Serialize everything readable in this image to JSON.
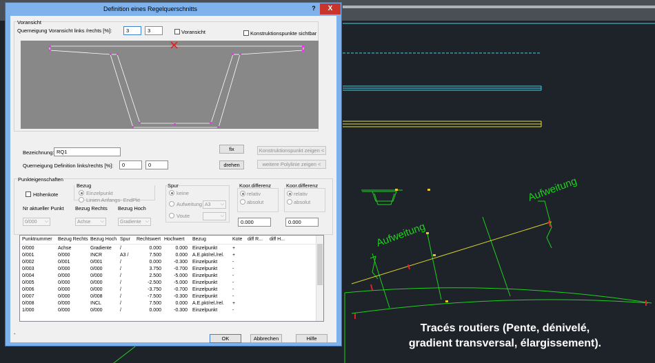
{
  "dialog": {
    "title": "Definition eines Regelquerschnitts",
    "help_glyph": "?",
    "close_glyph": "X",
    "preview_group": "Voransicht",
    "slope_label": "Querneigung Voransicht links /rechts [%]:",
    "slope_left": "3",
    "slope_right": "3",
    "voransicht_check": "Voransicht",
    "construction_points_check": "Konstruktionspunkte sichtbar",
    "name_label": "Bezeichnung:",
    "name_value": "RQ1",
    "slope_def_label": "Querneigung Definition links/rechts [%]:",
    "slope_def_left": "0",
    "slope_def_right": "0",
    "fix_button": "fix",
    "turn_button": "drehen",
    "show_construction_point_button": "Konstruktionspunkt zeigen <",
    "show_more_polyline_button": "weitere Polylinie zeigen <",
    "point_props_group": "Punkteigenschaften",
    "height_check": "Höhenkote",
    "current_point_label": "Nr aktueller Punkt",
    "current_point_value": "0/000",
    "bezug_group": "Bezug",
    "bezug_single": "Einzelpunkt",
    "bezug_lines": "Linien Anfangs- EndPkt",
    "bezug_right_label": "Bezug Rechts",
    "bezug_right_value": "Achse",
    "bezug_high_label": "Bezug Hoch",
    "bezug_high_value": "Gradiente",
    "spur_group": "Spur",
    "spur_none": "keine",
    "spur_widen": "Aufweitung",
    "spur_widen_value": "A3",
    "spur_voute": "Voute",
    "koor1_group": "Koor.differenz",
    "koor1_rel": "relativ",
    "koor1_abs": "absolut",
    "koor1_value": "0.000",
    "koor2_group": "Koor.differenz",
    "koor2_rel": "relativ",
    "koor2_abs": "absolut",
    "koor2_value": "0.000",
    "ok_button": "OK",
    "cancel_button": "Abbrechen",
    "help_button": "Hilfe",
    "footer_mark": "-"
  },
  "table": {
    "columns": [
      "Punktnummer",
      "Bezug Rechts",
      "Bezug Hoch",
      "Spur",
      "Rechtswert",
      "Hochwert",
      "Bezug",
      "Kote",
      "diff R...",
      "diff H..."
    ],
    "rows": [
      [
        "0/000",
        "Achse",
        "Gradiente",
        "/",
        "0.000",
        "0.000",
        "Einzelpunkt",
        "+"
      ],
      [
        "0/001",
        "0/000",
        "INCR",
        "A3 /",
        "7.500",
        "0.000",
        "A.E.pkt/rel./rel.",
        "+"
      ],
      [
        "0/002",
        "0/001",
        "0/001",
        "/",
        "0.000",
        "-0.300",
        "Einzelpunkt",
        "-"
      ],
      [
        "0/003",
        "0/000",
        "0/000",
        "/",
        "3.750",
        "-0.700",
        "Einzelpunkt",
        "-"
      ],
      [
        "0/004",
        "0/000",
        "0/000",
        "/",
        "2.500",
        "-5.000",
        "Einzelpunkt",
        "-"
      ],
      [
        "0/005",
        "0/000",
        "0/000",
        "/",
        "-2.500",
        "-5.000",
        "Einzelpunkt",
        "-"
      ],
      [
        "0/006",
        "0/000",
        "0/000",
        "/",
        "-3.750",
        "-0.700",
        "Einzelpunkt",
        "-"
      ],
      [
        "0/007",
        "0/000",
        "0/008",
        "/",
        "-7.500",
        "-0.300",
        "Einzelpunkt",
        "-"
      ],
      [
        "0/008",
        "0/000",
        "INCL",
        "/",
        "7.500",
        "0.000",
        "A.E.pkt/rel./rel.",
        "+"
      ],
      [
        "1/000",
        "0/000",
        "0/000",
        "/",
        "0.000",
        "-0.300",
        "Einzelpunkt",
        "-"
      ]
    ]
  },
  "cad": {
    "label_left": "Aufweitung",
    "label_right": "Aufweitung",
    "colors": {
      "background": "#1e2329",
      "cyan": "#3fd6e6",
      "yellow": "#e8e23a",
      "green": "#1ed21e",
      "red": "#e21f1f"
    }
  },
  "caption": {
    "line1": "Tracés routiers (Pente, dénivelé,",
    "line2": "gradient transversal, élargissement)."
  }
}
